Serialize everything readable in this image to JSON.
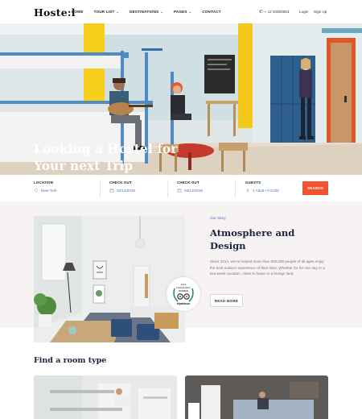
{
  "nav": {
    "logo": "Hoste:l",
    "menu": [
      {
        "label": "HOME",
        "caret": ""
      },
      {
        "label": "TOUR LIST",
        "caret": "⌄"
      },
      {
        "label": "DESTINATIONS",
        "caret": "⌄"
      },
      {
        "label": "PAGES",
        "caret": "⌄"
      },
      {
        "label": "CONTACT",
        "caret": ""
      }
    ],
    "phone": "+ 12 40503554",
    "login": "Login",
    "signup": "Sign Up"
  },
  "hero": {
    "title": "Looking a Hostel for Your next Trip"
  },
  "search": {
    "location": {
      "label": "LOCATION",
      "value": "New York"
    },
    "check_out_1": {
      "label": "CHECK OUT",
      "value": "03/12/2018"
    },
    "check_out_2": {
      "label": "CHECK OUT",
      "value": "03/12/2018"
    },
    "guests": {
      "label": "GUESTS",
      "value": "1 Adult  •  0 Child"
    },
    "button": "SEARCH"
  },
  "about": {
    "eyebrow": "Our Story",
    "title": "Atmosphere and Design",
    "body": "Since 2014, we've helped more than 500,000 people of all ages enjoy the best outdoor experience of their lives. Whether it's for one day or a two-week vacation, close to home or a foreign land.",
    "read_more": "READ MORE",
    "award": {
      "line1": "2019",
      "line2": "TRAVELERS'",
      "line3": "CHOICE",
      "brand": "tripadvisor"
    }
  },
  "rooms": {
    "title": "Find a room type"
  },
  "colors": {
    "accent": "#f0532e",
    "link": "#4a72c9",
    "heading": "#1c2340",
    "section_bg": "#f6f3f2"
  },
  "icons": {
    "phone": "phone-icon",
    "location": "location-pin-icon",
    "calendar": "calendar-icon",
    "guests": "user-icon"
  }
}
